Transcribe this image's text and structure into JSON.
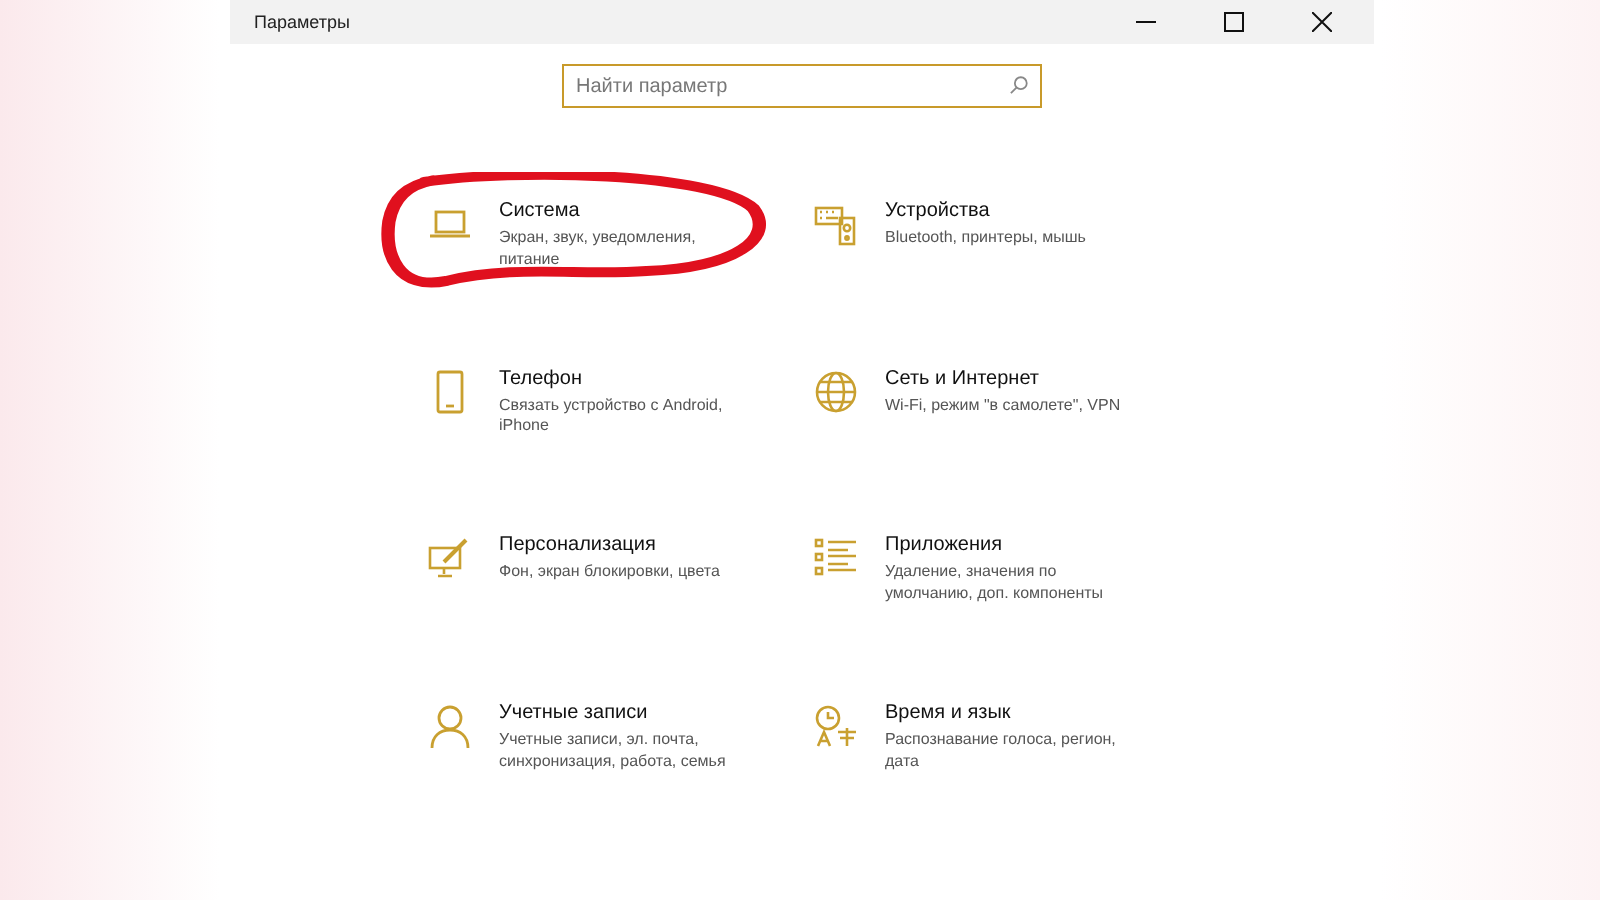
{
  "window": {
    "title": "Параметры"
  },
  "search": {
    "placeholder": "Найти параметр"
  },
  "categories": [
    {
      "title": "Система",
      "description": "Экран, звук, уведомления, питание",
      "circled": true
    },
    {
      "title": "Устройства",
      "description": "Bluetooth, принтеры, мышь",
      "circled": false
    },
    {
      "title": "Телефон",
      "description": "Связать устройство с Android, iPhone",
      "circled": false
    },
    {
      "title": "Сеть и Интернет",
      "description": "Wi-Fi, режим \"в самолете\", VPN",
      "circled": false
    },
    {
      "title": "Персонализация",
      "description": "Фон, экран блокировки, цвета",
      "circled": false
    },
    {
      "title": "Приложения",
      "description": "Удаление, значения по умолчанию, доп. компоненты",
      "circled": false
    },
    {
      "title": "Учетные записи",
      "description": "Учетные записи, эл. почта, синхронизация, работа, семья",
      "circled": false
    },
    {
      "title": "Время и язык",
      "description": "Распознавание голоса, регион, дата",
      "circled": false
    }
  ]
}
